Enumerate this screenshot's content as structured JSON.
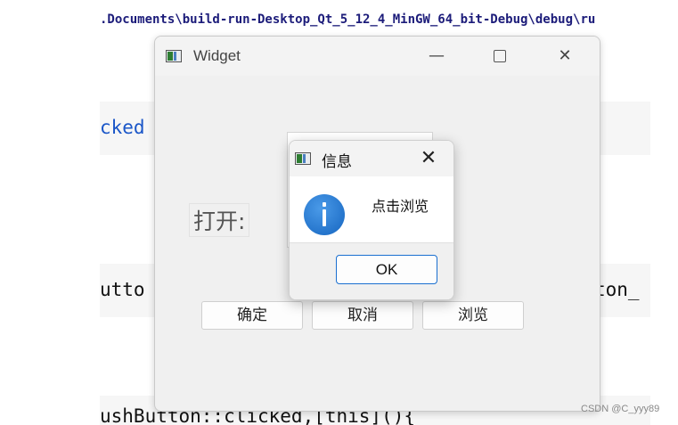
{
  "editor": {
    "path_line": ".Documents\\build-run-Desktop_Qt_5_12_4_MinGW_64_bit-Debug\\debug\\ru",
    "line_a": "cked",
    "line_b": "utto",
    "line_c": "ton_",
    "line_d": "ushButton::clicked,[this](){"
  },
  "widget": {
    "title": "Widget",
    "minimize": "—",
    "close": "✕",
    "open_label": "打开:",
    "buttons": {
      "confirm": "确定",
      "cancel": "取消",
      "browse": "浏览"
    }
  },
  "messagebox": {
    "title": "信息",
    "close": "✕",
    "text": "点击浏览",
    "ok": "OK",
    "icon": "info-icon"
  },
  "watermark": "CSDN @C_yyy89"
}
